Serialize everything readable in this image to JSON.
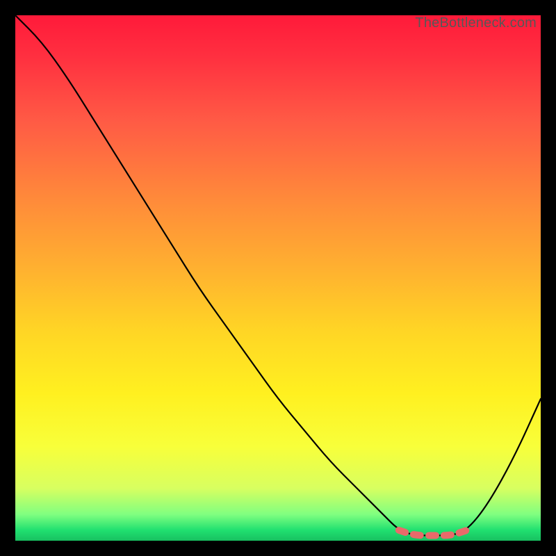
{
  "watermark": "TheBottleneck.com",
  "chart_data": {
    "type": "line",
    "title": "",
    "xlabel": "",
    "ylabel": "",
    "xlim": [
      0,
      100
    ],
    "ylim": [
      0,
      100
    ],
    "series": [
      {
        "name": "curve",
        "color": "#000000",
        "x": [
          0,
          5,
          10,
          15,
          20,
          25,
          30,
          35,
          40,
          45,
          50,
          55,
          60,
          65,
          70,
          73,
          76,
          80,
          83,
          86,
          90,
          95,
          100
        ],
        "values": [
          100,
          95,
          88,
          80,
          72,
          64,
          56,
          48,
          41,
          34,
          27,
          21,
          15,
          10,
          5,
          2,
          1,
          1,
          1,
          2,
          7,
          16,
          27
        ]
      },
      {
        "name": "highlight",
        "color": "#e96a6a",
        "style": "dashed-thick",
        "x": [
          73,
          76,
          80,
          83,
          86
        ],
        "values": [
          2,
          1,
          1,
          1,
          2
        ]
      }
    ],
    "gradient_background": {
      "top": "#ff1a3a",
      "middle": "#ffd525",
      "bottom": "#18c060"
    }
  }
}
